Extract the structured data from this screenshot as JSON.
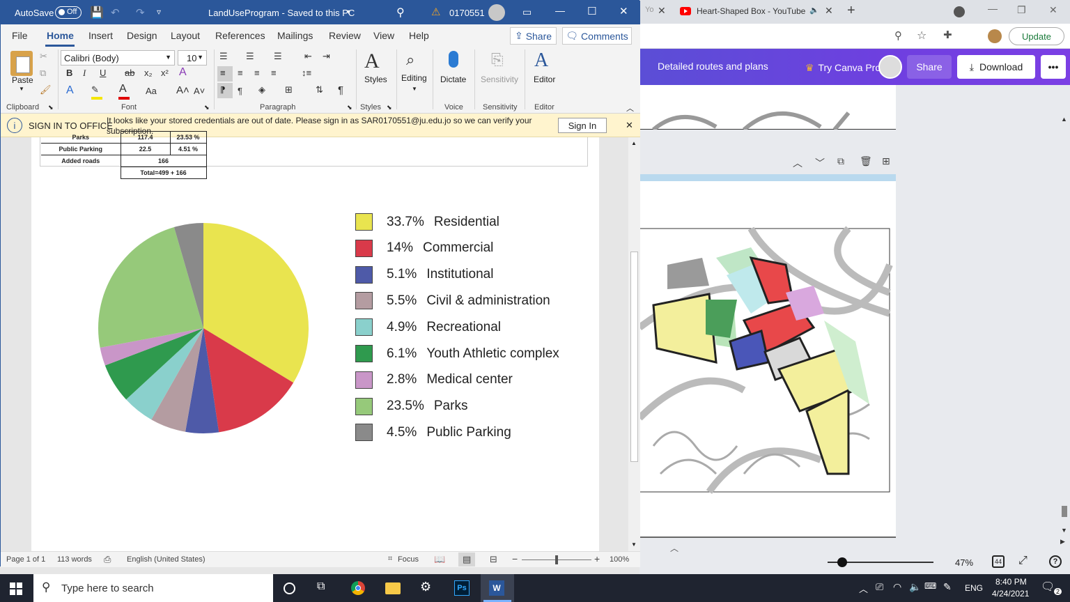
{
  "word": {
    "autosave_label": "AutoSave",
    "autosave_state": "Off",
    "doc_title": "LandUseProgram  -  Saved to this PC",
    "account_warning": "0170551",
    "menu": [
      "File",
      "Home",
      "Insert",
      "Design",
      "Layout",
      "References",
      "Mailings",
      "Review",
      "View",
      "Help"
    ],
    "share_label": "Share",
    "comments_label": "Comments",
    "font_name": "Calibri (Body)",
    "font_size": "10",
    "groups": {
      "clipboard": "Clipboard",
      "font": "Font",
      "paragraph": "Paragraph",
      "styles": "Styles",
      "voice": "Voice",
      "sensitivity": "Sensitivity",
      "editor": "Editor"
    },
    "buttons": {
      "paste": "Paste",
      "styles": "Styles",
      "editing": "Editing",
      "dictate": "Dictate",
      "sensitivity": "Sensitivity",
      "editor": "Editor"
    },
    "infobar": {
      "title": "SIGN IN TO OFFICE",
      "message": "It looks like your stored credentials are out of date. Please sign in as SAR0170551@ju.edu.jo so we can verify your subscription.",
      "button": "Sign In"
    },
    "table": {
      "rows": [
        {
          "name": "Parks",
          "value": "117.4",
          "pct": "23.53 %"
        },
        {
          "name": "Public Parking",
          "value": "22.5",
          "pct": "4.51 %"
        },
        {
          "name": "Added roads",
          "value": "166",
          "pct": ""
        }
      ],
      "total": "Total=499 + 166"
    },
    "status": {
      "page": "Page 1 of 1",
      "words": "113 words",
      "language": "English (United States)",
      "focus": "Focus",
      "zoom": "100%"
    }
  },
  "chart_data": {
    "type": "pie",
    "categories": [
      "Residential",
      "Commercial",
      "Institutional",
      "Civil & administration",
      "Recreational",
      "Youth Athletic complex",
      "Medical center",
      "Parks",
      "Public Parking"
    ],
    "values": [
      33.7,
      14,
      5.1,
      5.5,
      4.9,
      6.1,
      2.8,
      23.5,
      4.5
    ],
    "labels": [
      "33.7%",
      "14%",
      "5.1%",
      "5.5%",
      "4.9%",
      "6.1%",
      "2.8%",
      "23.5%",
      "4.5%"
    ],
    "colors": [
      "#e9e44f",
      "#d93a4a",
      "#4e5aa8",
      "#b49ca1",
      "#8ad0cc",
      "#2f9a4e",
      "#c996c8",
      "#96c97a",
      "#8a8a8a"
    ],
    "legend_position": "right"
  },
  "browser": {
    "tab_title": "Heart-Shaped Box - YouTube",
    "update_label": "Update",
    "canva": {
      "doc_title": "Detailed routes and plans",
      "try_pro": "Try Canva Pro",
      "share": "Share",
      "download": "Download",
      "zoom": "47%",
      "pages": "44"
    }
  },
  "taskbar": {
    "search_placeholder": "Type here to search",
    "lang": "ENG",
    "time": "8:40 PM",
    "date": "4/24/2021",
    "notifications": "2"
  }
}
